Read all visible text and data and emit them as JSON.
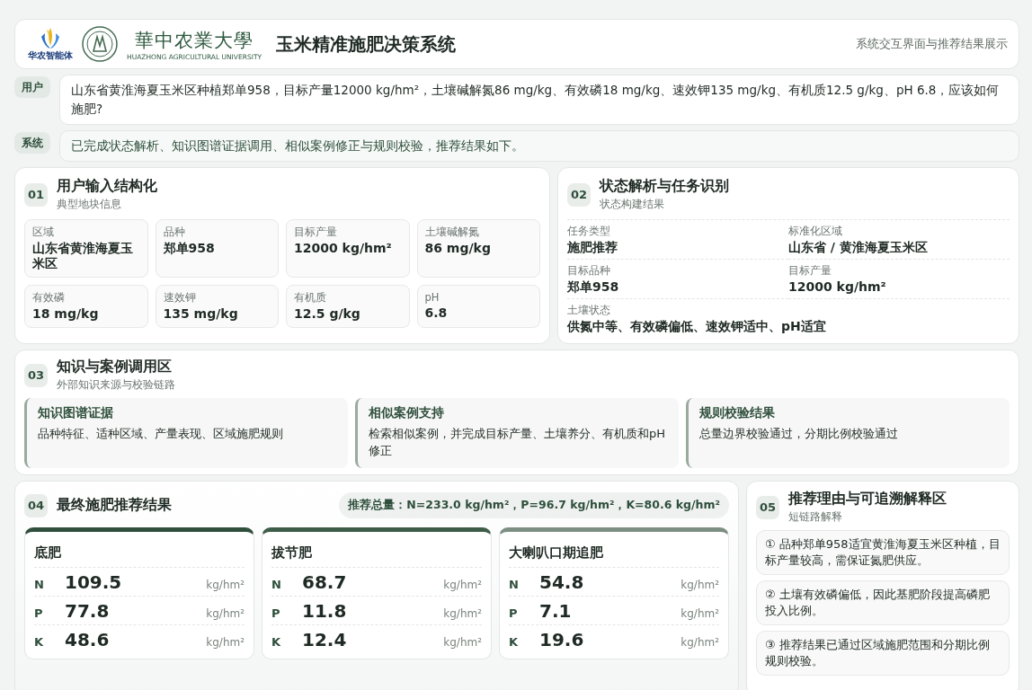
{
  "header": {
    "logo_caption": "华农智能体",
    "university_name": "華中农業大學",
    "university_name_en": "HUAZHONG AGRICULTURAL UNIVERSITY",
    "title": "玉米精准施肥决策系统",
    "subtitle": "系统交互界面与推荐结果展示"
  },
  "conversation": [
    {
      "role": "用户",
      "text": "山东省黄淮海夏玉米区种植郑单958，目标产量12000 kg/hm²，土壤碱解氮86 mg/kg、有效磷18 mg/kg、速效钾135 mg/kg、有机质12.5 g/kg、pH 6.8，应该如何施肥?"
    },
    {
      "role": "系统",
      "text": "已完成状态解析、知识图谱证据调用、相似案例修正与规则校验，推荐结果如下。"
    }
  ],
  "input_section": {
    "number": "01",
    "title": "用户输入结构化",
    "subtitle": "典型地块信息",
    "fields": [
      {
        "label": "区域",
        "value": "山东省黄淮海夏玉米区"
      },
      {
        "label": "品种",
        "value": "郑单958"
      },
      {
        "label": "目标产量",
        "value": "12000 kg/hm²"
      },
      {
        "label": "土壤碱解氮",
        "value": "86 mg/kg"
      },
      {
        "label": "有效磷",
        "value": "18 mg/kg"
      },
      {
        "label": "速效钾",
        "value": "135 mg/kg"
      },
      {
        "label": "有机质",
        "value": "12.5 g/kg"
      },
      {
        "label": "pH",
        "value": "6.8"
      }
    ]
  },
  "state_section": {
    "number": "02",
    "title": "状态解析与任务识别",
    "subtitle": "状态构建结果",
    "fields": [
      {
        "label": "任务类型",
        "value": "施肥推荐"
      },
      {
        "label": "标准化区域",
        "value": "山东省 / 黄淮海夏玉米区"
      },
      {
        "label": "目标品种",
        "value": "郑单958"
      },
      {
        "label": "目标产量",
        "value": "12000 kg/hm²"
      },
      {
        "label": "土壤状态",
        "value": "供氮中等、有效磷偏低、速效钾适中、pH适宜"
      }
    ]
  },
  "knowledge_section": {
    "number": "03",
    "title": "知识与案例调用区",
    "subtitle": "外部知识来源与校验链路",
    "items": [
      {
        "title": "知识图谱证据",
        "text": "品种特征、适种区域、产量表现、区域施肥规则"
      },
      {
        "title": "相似案例支持",
        "text": "检索相似案例，并完成目标产量、土壤养分、有机质和pH修正"
      },
      {
        "title": "规则校验结果",
        "text": "总量边界校验通过，分期比例校验通过"
      }
    ]
  },
  "result_section": {
    "number": "04",
    "title": "最终施肥推荐结果",
    "summary": "推荐总量：N=233.0 kg/hm²，P=96.7 kg/hm²，K=80.6 kg/hm²",
    "stages": [
      {
        "name": "底肥",
        "color": "#2f4f3c",
        "rows": [
          {
            "nutrient": "N",
            "value": "109.5",
            "unit": "kg/hm²"
          },
          {
            "nutrient": "P",
            "value": "77.8",
            "unit": "kg/hm²"
          },
          {
            "nutrient": "K",
            "value": "48.6",
            "unit": "kg/hm²"
          }
        ]
      },
      {
        "name": "拔节肥",
        "color": "#3e5d48",
        "rows": [
          {
            "nutrient": "N",
            "value": "68.7",
            "unit": "kg/hm²"
          },
          {
            "nutrient": "P",
            "value": "11.8",
            "unit": "kg/hm²"
          },
          {
            "nutrient": "K",
            "value": "12.4",
            "unit": "kg/hm²"
          }
        ]
      },
      {
        "name": "大喇叭口期追肥",
        "color": "#7d8e83",
        "rows": [
          {
            "nutrient": "N",
            "value": "54.8",
            "unit": "kg/hm²"
          },
          {
            "nutrient": "P",
            "value": "7.1",
            "unit": "kg/hm²"
          },
          {
            "nutrient": "K",
            "value": "19.6",
            "unit": "kg/hm²"
          }
        ]
      }
    ]
  },
  "reason_section": {
    "number": "05",
    "title": "推荐理由与可追溯解释区",
    "subtitle": "短链路解释",
    "reasons": [
      "① 品种郑单958适宜黄淮海夏玉米区种植，目标产量较高，需保证氮肥供应。",
      "② 土壤有效磷偏低，因此基肥阶段提高磷肥投入比例。",
      "③ 推荐结果已通过区域施肥范围和分期比例规则校验。"
    ]
  }
}
